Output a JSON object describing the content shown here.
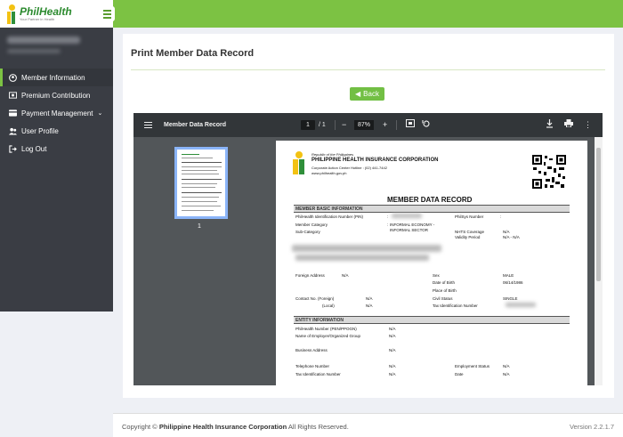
{
  "header": {
    "brand": "PhilHealth",
    "tagline": "Your Partner in Health"
  },
  "sidebar": {
    "items": [
      {
        "label": "Member Information",
        "icon": "user-circle-icon"
      },
      {
        "label": "Premium Contribution",
        "icon": "money-icon"
      },
      {
        "label": "Payment Management",
        "icon": "credit-card-icon"
      },
      {
        "label": "User Profile",
        "icon": "users-icon"
      },
      {
        "label": "Log Out",
        "icon": "sign-out-icon"
      }
    ]
  },
  "main": {
    "title": "Print Member Data Record",
    "back_label": "Back"
  },
  "viewer": {
    "title": "Member Data Record",
    "page_current": "1",
    "page_total": "/ 1",
    "zoom": "87%",
    "thumb_page": "1"
  },
  "doc": {
    "republic": "Republic of the Philippines",
    "corp": "PHILIPPINE HEALTH INSURANCE CORPORATION",
    "hotline": "Corporate Action Center Hotline : (02) 441-7442",
    "website": "www.philhealth.gov.ph",
    "heading": "MEMBER DATA RECORD",
    "sec1": "MEMBER BASIC INFORMATION",
    "pin_label": "PhilHealth Identification Number (PIN)",
    "colon": ":",
    "philsys_label": "PhilSys Number",
    "category_label": "Member Category",
    "category_val": "INFORMAL ECONOMY -",
    "subcat_label": "Sub-Category",
    "subcat_val": "INFORMAL SECTOR",
    "nhts_label": "NHTS Coverage",
    "nhts_val": "N/A",
    "validity_label": "Validity Period",
    "validity_val": "N/A - N/A",
    "foreign_label": "Foreign Address",
    "foreign_val": "N/A",
    "sex_label": "Sex",
    "sex_val": "MALE",
    "dob_label": "Date of Birth",
    "dob_val": "06/14/1986",
    "pob_label": "Place of Birth",
    "contact_label": "Contact No. (Foreign)",
    "contact_val": "N/A",
    "local_label": "(Local)",
    "local_val": "N/A",
    "civil_label": "Civil Status",
    "civil_val": "SINGLE",
    "tin_label": "Tax Identification Number",
    "sec2": "ENTITY INFORMATION",
    "pen_label": "PhilHealth Number (PEN/PPOGN)",
    "pen_val": "N/A",
    "employer_label": "Name of Employer/Organized Group",
    "employer_val": "N/A",
    "baddr_label": "Business Address",
    "baddr_val": "N/A",
    "tel_label": "Telephone Number",
    "tel_val": "N/A",
    "empstat_label": "Employment Status",
    "empstat_val": "N/A",
    "etin_label": "Tax Identification Number",
    "etin_val": "N/A",
    "date_label": "Date",
    "date_val": "N/A"
  },
  "footer": {
    "copy_prefix": "Copyright ©",
    "org": "Philippine Health Insurance Corporation",
    "rights": "All Rights Reserved.",
    "version": "Version 2.2.1.7"
  },
  "colors": {
    "accent": "#7cc243",
    "sidebar": "#3a3d44",
    "viewer_toolbar": "#323639"
  }
}
